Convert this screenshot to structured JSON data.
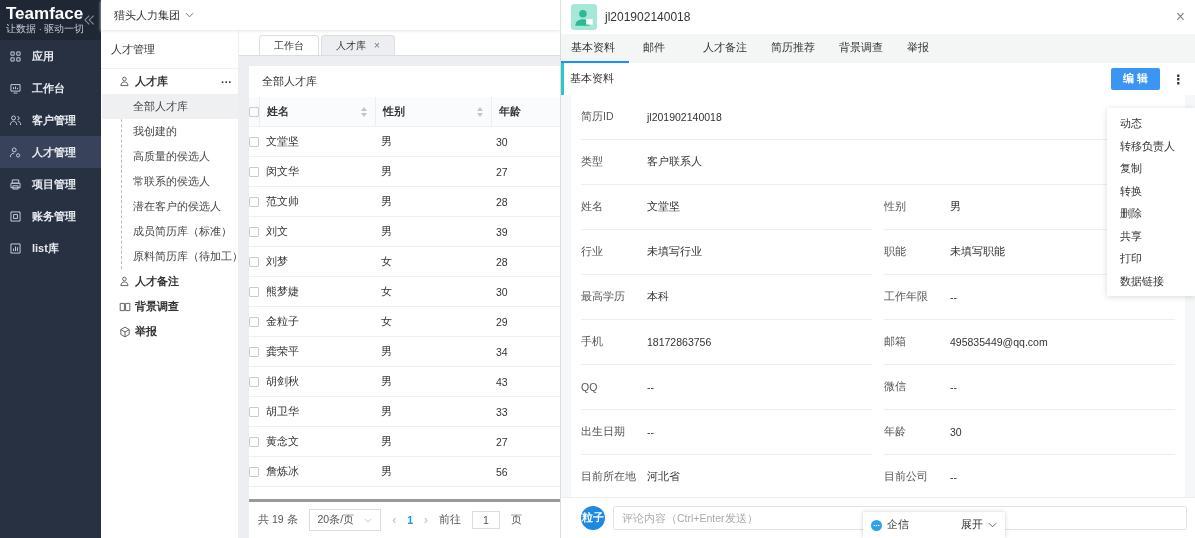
{
  "logo": {
    "name": "Teamface",
    "slogan": "让数据 · 驱动一切"
  },
  "nav": [
    {
      "label": "应用",
      "selected": false
    },
    {
      "label": "工作台",
      "selected": false
    },
    {
      "label": "客户管理",
      "selected": false
    },
    {
      "label": "人才管理",
      "selected": true
    },
    {
      "label": "项目管理",
      "selected": false
    },
    {
      "label": "账务管理",
      "selected": false
    },
    {
      "label": "list库",
      "selected": false
    }
  ],
  "company": "猎头人力集团",
  "submenu": {
    "title": "人才管理",
    "groups": [
      {
        "label": "人才库",
        "more": "···",
        "children": [
          {
            "label": "全部人才库",
            "selected": true
          },
          {
            "label": "我创建的",
            "selected": false
          },
          {
            "label": "高质量的侯选人",
            "selected": false
          },
          {
            "label": "常联系的侯选人",
            "selected": false
          },
          {
            "label": "潜在客户的侯选人",
            "selected": false
          },
          {
            "label": "成员简历库（标准）",
            "selected": false
          },
          {
            "label": "原料简历库（待加工）",
            "selected": false
          }
        ]
      },
      {
        "label": "人才备注"
      },
      {
        "label": "背景调查"
      },
      {
        "label": "举报"
      }
    ]
  },
  "page_tabs": [
    {
      "label": "工作台",
      "selected": false,
      "closable": false
    },
    {
      "label": "人才库",
      "selected": true,
      "closable": true,
      "close": "×"
    }
  ],
  "list": {
    "title": "全部人才库",
    "all_checked": false,
    "columns": [
      {
        "label": "姓名",
        "sortable": true
      },
      {
        "label": "性别",
        "sortable": true
      },
      {
        "label": "年龄",
        "sortable": false
      }
    ],
    "rows": [
      {
        "cells": [
          "文堂坚",
          "男",
          "30"
        ],
        "checked": false
      },
      {
        "cells": [
          "闵文华",
          "男",
          "27"
        ],
        "checked": false
      },
      {
        "cells": [
          "范文帅",
          "男",
          "28"
        ],
        "checked": false
      },
      {
        "cells": [
          "刘文",
          "男",
          "39"
        ],
        "checked": false
      },
      {
        "cells": [
          "刘梦",
          "女",
          "28"
        ],
        "checked": false
      },
      {
        "cells": [
          "熊梦婕",
          "女",
          "30"
        ],
        "checked": false
      },
      {
        "cells": [
          "金粒子",
          "女",
          "29"
        ],
        "checked": false
      },
      {
        "cells": [
          "龚荣平",
          "男",
          "34"
        ],
        "checked": false
      },
      {
        "cells": [
          "胡剑秋",
          "男",
          "43"
        ],
        "checked": false
      },
      {
        "cells": [
          "胡卫华",
          "男",
          "33"
        ],
        "checked": false
      },
      {
        "cells": [
          "黄念文",
          "男",
          "27"
        ],
        "checked": false
      },
      {
        "cells": [
          "詹炼冰",
          "男",
          "56"
        ],
        "checked": false
      }
    ]
  },
  "pagination": {
    "total": "共 19 条",
    "page_size": "20条/页",
    "prev": "‹",
    "pages": [
      {
        "label": "1",
        "selected": true
      }
    ],
    "next": "›",
    "goto_label": "前往",
    "goto_value": "1",
    "goto_suffix": "页"
  },
  "detail": {
    "title": "jl201902140018",
    "close": "×",
    "tabs": [
      {
        "label": "基本资料",
        "selected": true
      },
      {
        "label": "邮件",
        "selected": false
      },
      {
        "label": "人才备注",
        "selected": false
      },
      {
        "label": "简历推荐",
        "selected": false
      },
      {
        "label": "背景调查",
        "selected": false
      },
      {
        "label": "举报",
        "selected": false
      }
    ],
    "section": "基本资料",
    "edit": "编 辑",
    "more": "⋮",
    "fields": [
      {
        "kind": "full",
        "label": "简历ID",
        "value": "jl201902140018"
      },
      {
        "kind": "full",
        "label": "类型",
        "value": "客户联系人"
      },
      {
        "kind": "half",
        "label": "姓名",
        "value": "文堂坚"
      },
      {
        "kind": "half",
        "label": "性别",
        "value": "男"
      },
      {
        "kind": "half",
        "label": "行业",
        "value": "未填写行业"
      },
      {
        "kind": "half",
        "label": "职能",
        "value": "未填写职能"
      },
      {
        "kind": "half",
        "label": "最高学历",
        "value": "本科"
      },
      {
        "kind": "half",
        "label": "工作年限",
        "value": "--"
      },
      {
        "kind": "half",
        "label": "手机",
        "value": "18172863756"
      },
      {
        "kind": "half",
        "label": "邮箱",
        "value": "495835449@qq.com"
      },
      {
        "kind": "half",
        "label": "QQ",
        "value": "--"
      },
      {
        "kind": "half",
        "label": "微信",
        "value": "--"
      },
      {
        "kind": "half",
        "label": "出生日期",
        "value": "--"
      },
      {
        "kind": "half",
        "label": "年龄",
        "value": "30"
      },
      {
        "kind": "half",
        "label": "目前所在地",
        "value": "河北省"
      },
      {
        "kind": "half",
        "label": "目前公司",
        "value": "--"
      }
    ],
    "menu": [
      "动态",
      "转移负责人",
      "复制",
      "转换",
      "删除",
      "共享",
      "打印",
      "数据链接"
    ],
    "comment_avatar": "粒子",
    "comment_placeholder": "评论内容（Ctrl+Enter发送）"
  },
  "chat": {
    "label": "企信",
    "expand": "展开"
  }
}
